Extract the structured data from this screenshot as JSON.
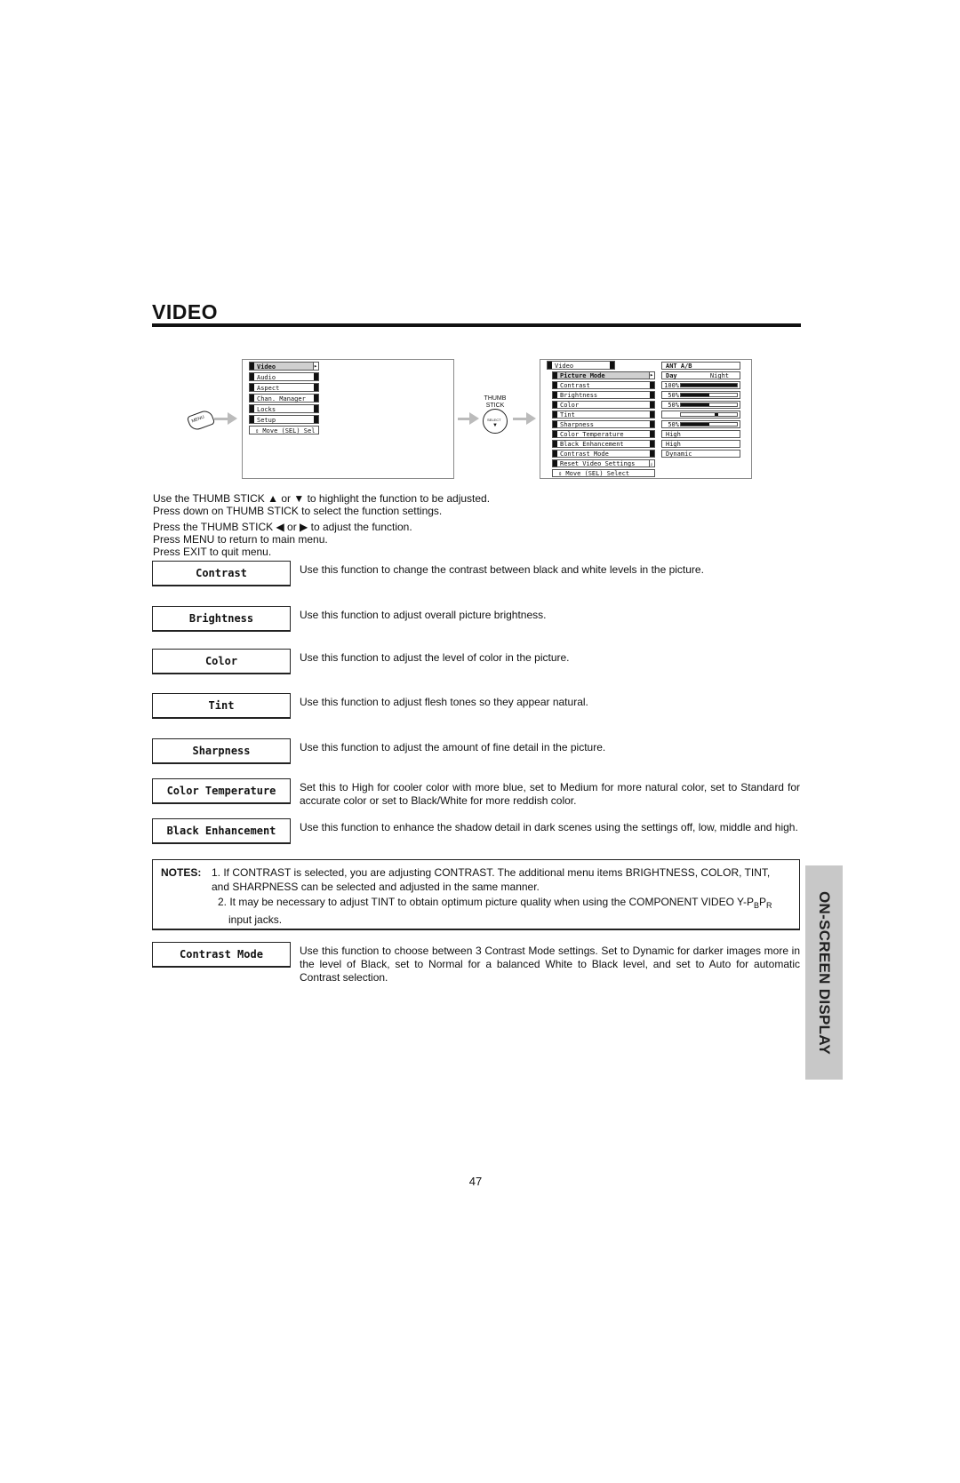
{
  "page": {
    "title": "VIDEO",
    "page_number": "47",
    "side_tab": "ON-SCREEN DISPLAY"
  },
  "diagram": {
    "menu_button_label": "MENU",
    "thumb_stick_label": "THUMB STICK",
    "select_label": "SELECT",
    "main_menu": {
      "items": [
        "Video",
        "Audio",
        "Aspect",
        "Chan. Manager",
        "Locks",
        "Setup"
      ],
      "selected": "Video",
      "footer": "⇕ Move (SEL) Sel"
    },
    "video_menu": {
      "header": "Video",
      "input_label": "ANT A/B",
      "items": [
        "Picture Mode",
        "Contrast",
        "Brightness",
        "Color",
        "Tint",
        "Sharpness",
        "Color Temperature",
        "Black Enhancement",
        "Contrast Mode",
        "Reset Video Settings"
      ],
      "selected": "Picture Mode",
      "footer": "⇕ Move (SEL) Select",
      "values": {
        "picture_mode": {
          "left": "Day",
          "right": "Night"
        },
        "contrast": {
          "label": "100%",
          "level": 1.0
        },
        "brightness": {
          "label": "50%",
          "level": 0.5
        },
        "color": {
          "label": "50%",
          "level": 0.5
        },
        "tint": {
          "level": 0.5
        },
        "sharpness": {
          "label": "50%",
          "level": 0.5
        },
        "color_temperature": "High",
        "black_enhancement": "High",
        "contrast_mode": "Dynamic"
      }
    }
  },
  "instructions": [
    "Use the THUMB STICK ▲ or ▼ to highlight the function to be adjusted.",
    "Press down on THUMB STICK to select the function settings.",
    "Press the THUMB STICK ◀ or ▶ to adjust the function.",
    "Press MENU to return to main menu.",
    "Press EXIT to quit menu."
  ],
  "functions": [
    {
      "name": "Contrast",
      "description": "Use this function to change the contrast between black and white levels in the picture."
    },
    {
      "name": "Brightness",
      "description": "Use this function to adjust overall picture brightness."
    },
    {
      "name": "Color",
      "description": "Use this function to adjust the level of color in the picture."
    },
    {
      "name": "Tint",
      "description": "Use this function to adjust flesh tones so they appear natural."
    },
    {
      "name": "Sharpness",
      "description": "Use this function to adjust the amount of fine detail in the picture."
    },
    {
      "name": "Color Temperature",
      "description": "Set this to High for cooler color with more blue, set to Medium for more natural color, set to Standard for accurate color or set to Black/White for more reddish color."
    },
    {
      "name": "Black Enhancement",
      "description": "Use this function to enhance the shadow detail in dark scenes using the settings off, low, middle and high."
    },
    {
      "name": "Contrast Mode",
      "description": "Use this function to choose between 3 Contrast Mode settings.  Set to Dynamic for darker images more in the level of Black, set to Normal for a balanced White to Black level, and set to Auto for automatic Contrast selection."
    }
  ],
  "notes": {
    "label": "NOTES:",
    "items": [
      "1.   If CONTRAST is selected, you are adjusting CONTRAST.  The additional menu items BRIGHTNESS, COLOR, TINT, and SHARPNESS can be selected and adjusted in the same manner.",
      "2.   It may be necessary to adjust TINT to obtain optimum picture quality when using the COMPONENT VIDEO Y-P",
      "B",
      "P",
      "R",
      " input jacks."
    ]
  }
}
